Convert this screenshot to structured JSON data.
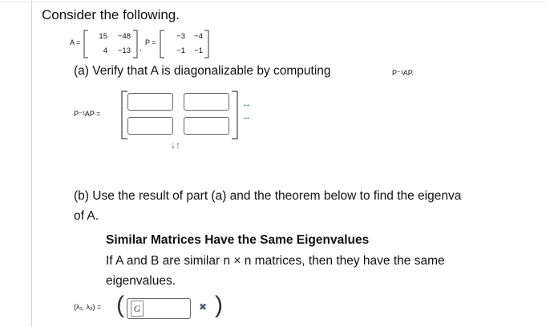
{
  "problem": {
    "intro": "Consider the following.",
    "matrix_A": {
      "label": "A =",
      "rows": [
        [
          "15",
          "−48"
        ],
        [
          "4",
          "−13"
        ]
      ]
    },
    "comma": ",",
    "matrix_P": {
      "label": "P =",
      "rows": [
        [
          "−3",
          "−4"
        ],
        [
          "−1",
          "−1"
        ]
      ]
    }
  },
  "part_a": {
    "text": "(a) Verify that A is diagonalizable by computing",
    "expr": "P⁻¹AP.",
    "answer_label": "P⁻¹AP =",
    "cells": [
      "",
      "",
      "",
      ""
    ],
    "col_arrows": "↓↑",
    "row_arrows": "↔"
  },
  "part_b": {
    "line1": "(b) Use the result of part (a) and the theorem below to find the eigenva",
    "line2": "of A.",
    "theorem_title": "Similar Matrices Have the Same Eigenvalues",
    "theorem_line1": "If A and B are similar n × n matrices, then they have the same",
    "theorem_line2": "eigenvalues.",
    "answer_label": "(λ₁, λ₂) =",
    "answer_value": "",
    "g_icon_text": "G",
    "status_mark": "✖",
    "status_color": "#4a5a7a"
  }
}
